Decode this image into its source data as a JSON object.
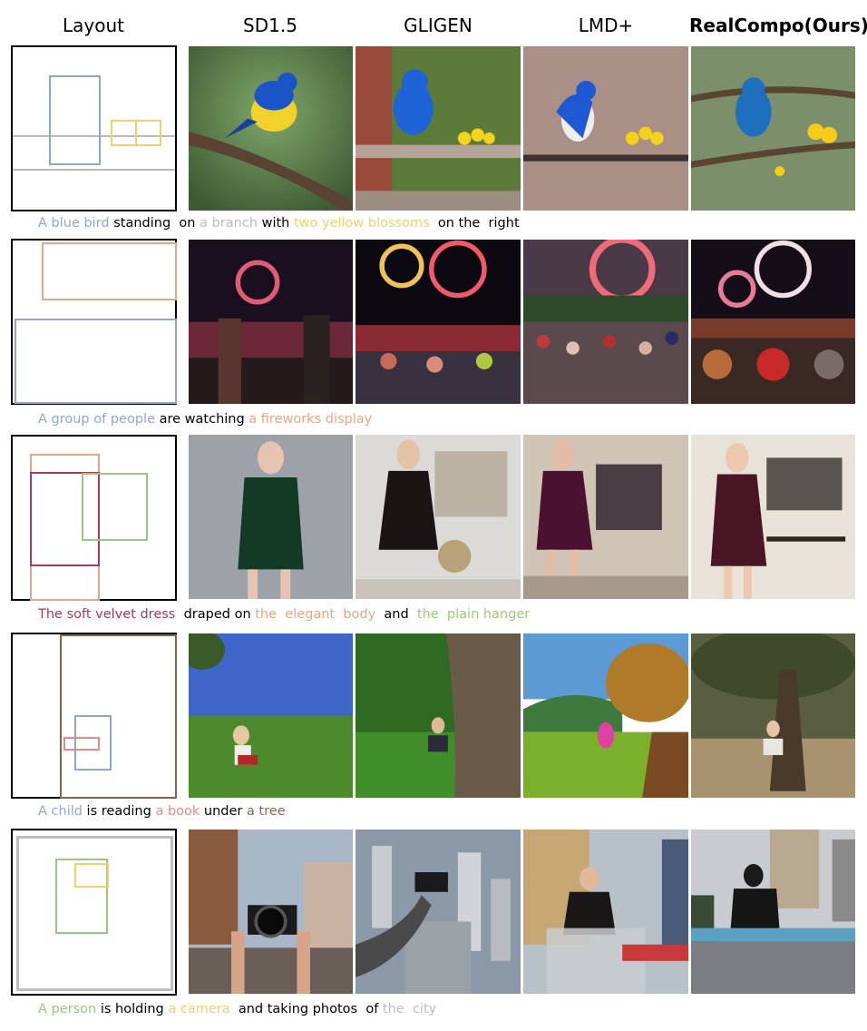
{
  "headers": [
    "Layout",
    "SD1.5",
    "GLIGEN",
    "LMD+",
    "RealCompo(Ours)"
  ],
  "colors": {
    "blue": "#8fa7cf",
    "gray": "#bdbdbd",
    "yellow": "#f2cf6a",
    "salmon": "#e4a882",
    "maroon": "#a8385e",
    "green": "#9cc77e",
    "brown": "#8b6446",
    "pink": "#e08a8a",
    "black": "#000000"
  },
  "rows": [
    {
      "caption": [
        {
          "text": "A blue bird",
          "color": "blue"
        },
        {
          "text": " standing  on ",
          "color": "black"
        },
        {
          "text": "a branch",
          "color": "gray"
        },
        {
          "text": " with ",
          "color": "black"
        },
        {
          "text": "two yellow blossoms",
          "color": "yellow"
        },
        {
          "text": "  on the  right",
          "color": "black"
        }
      ]
    },
    {
      "caption": [
        {
          "text": "A group of people",
          "color": "blue"
        },
        {
          "text": " are watching ",
          "color": "black"
        },
        {
          "text": "a fireworks display",
          "color": "salmon"
        }
      ]
    },
    {
      "caption": [
        {
          "text": "The soft velvet dress",
          "color": "maroon"
        },
        {
          "text": "  draped on ",
          "color": "black"
        },
        {
          "text": "the  elegant  body",
          "color": "salmon"
        },
        {
          "text": "  and  ",
          "color": "black"
        },
        {
          "text": "the  plain hanger",
          "color": "green"
        }
      ]
    },
    {
      "caption": [
        {
          "text": "A child",
          "color": "blue"
        },
        {
          "text": " is reading ",
          "color": "black"
        },
        {
          "text": "a book",
          "color": "pink"
        },
        {
          "text": " under ",
          "color": "black"
        },
        {
          "text": "a tree",
          "color": "brown"
        }
      ]
    },
    {
      "caption": [
        {
          "text": "A person",
          "color": "green"
        },
        {
          "text": " is holding ",
          "color": "black"
        },
        {
          "text": "a camera",
          "color": "yellow"
        },
        {
          "text": "  and taking photos  of ",
          "color": "black"
        },
        {
          "text": "the  city",
          "color": "gray"
        }
      ]
    }
  ]
}
